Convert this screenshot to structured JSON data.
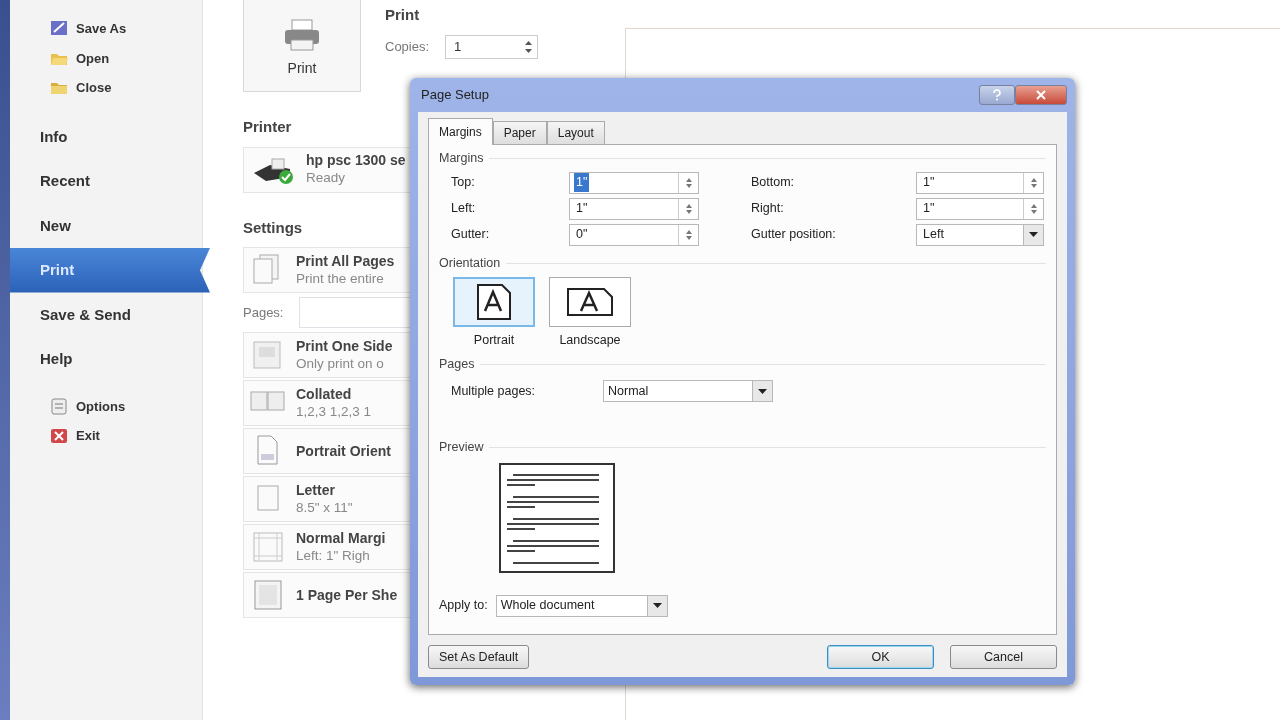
{
  "backstage": {
    "items": [
      {
        "label": "Save As",
        "kind": "command",
        "selected": false
      },
      {
        "label": "Open",
        "kind": "command",
        "selected": false
      },
      {
        "label": "Close",
        "kind": "command",
        "selected": false
      },
      {
        "label": "Info",
        "kind": "section",
        "selected": false
      },
      {
        "label": "Recent",
        "kind": "section",
        "selected": false
      },
      {
        "label": "New",
        "kind": "section",
        "selected": false
      },
      {
        "label": "Print",
        "kind": "section",
        "selected": true
      },
      {
        "label": "Save & Send",
        "kind": "section",
        "selected": false
      },
      {
        "label": "Help",
        "kind": "section",
        "selected": false
      },
      {
        "label": "Options",
        "kind": "command",
        "selected": false
      },
      {
        "label": "Exit",
        "kind": "command",
        "selected": false
      }
    ]
  },
  "print_pane": {
    "print_button": "Print",
    "title": "Print",
    "copies_label": "Copies:",
    "copies_value": "1",
    "printer_heading": "Printer",
    "printer_name": "hp psc 1300 se",
    "printer_status": "Ready",
    "settings_heading": "Settings",
    "settings": [
      {
        "kind": "option",
        "title": "Print All Pages",
        "subtitle": "Print the entire"
      },
      {
        "kind": "pages",
        "title": "Pages:"
      },
      {
        "kind": "option",
        "title": "Print One Side",
        "subtitle": "Only print on o"
      },
      {
        "kind": "option",
        "title": "Collated",
        "subtitle": "1,2,3    1,2,3    1"
      },
      {
        "kind": "option",
        "title": "Portrait Orient"
      },
      {
        "kind": "option",
        "title": "Letter",
        "subtitle": "8.5\" x 11\""
      },
      {
        "kind": "option",
        "title": "Normal Margi",
        "subtitle": "Left: 1\"    Righ"
      },
      {
        "kind": "option",
        "title": "1 Page Per She"
      }
    ]
  },
  "dialog": {
    "title": "Page Setup",
    "tabs": [
      {
        "label": "Margins",
        "selected": true
      },
      {
        "label": "Paper",
        "selected": false
      },
      {
        "label": "Layout",
        "selected": false
      }
    ],
    "margins_heading": "Margins",
    "fields": [
      {
        "label": "Top:",
        "value": "1\"",
        "kind": "spin",
        "text_selected": true
      },
      {
        "label": "Bottom:",
        "value": "1\"",
        "kind": "spin",
        "text_selected": false
      },
      {
        "label": "Left:",
        "value": "1\"",
        "kind": "spin",
        "text_selected": false
      },
      {
        "label": "Right:",
        "value": "1\"",
        "kind": "spin",
        "text_selected": false
      },
      {
        "label": "Gutter:",
        "value": "0\"",
        "kind": "spin",
        "text_selected": false
      },
      {
        "label": "Gutter position:",
        "value": "Left",
        "kind": "dropdown",
        "text_selected": false
      }
    ],
    "orientation_heading": "Orientation",
    "orientations": [
      {
        "label": "Portrait",
        "kind": "portrait",
        "selected": true
      },
      {
        "label": "Landscape",
        "kind": "landscape",
        "selected": false
      }
    ],
    "pages_heading": "Pages",
    "multiple_pages_label": "Multiple pages:",
    "multiple_pages_value": "Normal",
    "preview_heading": "Preview",
    "apply_label": "Apply to:",
    "apply_value": "Whole document",
    "buttons": [
      {
        "label": "Set As Default",
        "kind": "secondary"
      },
      {
        "label": "OK",
        "kind": "default"
      },
      {
        "label": "Cancel",
        "kind": "secondary"
      }
    ]
  }
}
